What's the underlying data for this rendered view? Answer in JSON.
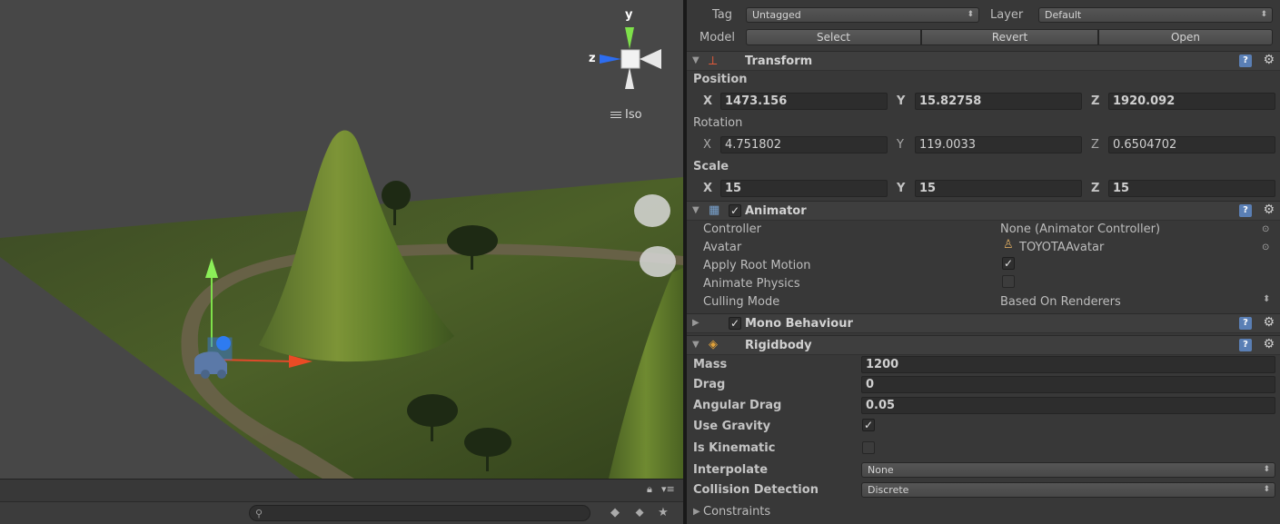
{
  "scene": {
    "gizmo": {
      "y_label": "y",
      "z_label": "z"
    },
    "projection_label": "Iso",
    "footer_icons": [
      "lock-icon",
      "menu-icon",
      "search-icon",
      "shapes-icon",
      "tag-icon",
      "star-icon"
    ]
  },
  "inspector": {
    "tag_label": "Tag",
    "tag_value": "Untagged",
    "layer_label": "Layer",
    "layer_value": "Default",
    "model_label": "Model",
    "model_buttons": {
      "select": "Select",
      "revert": "Revert",
      "open": "Open"
    },
    "transform": {
      "title": "Transform",
      "position_label": "Position",
      "position": {
        "x": "1473.156",
        "y": "15.82758",
        "z": "1920.092"
      },
      "rotation_label": "Rotation",
      "rotation": {
        "x": "4.751802",
        "y": "119.0033",
        "z": "0.6504702"
      },
      "scale_label": "Scale",
      "scale": {
        "x": "15",
        "y": "15",
        "z": "15"
      },
      "axis": {
        "x": "X",
        "y": "Y",
        "z": "Z"
      }
    },
    "animator": {
      "title": "Animator",
      "enabled": true,
      "controller_label": "Controller",
      "controller_value": "None (Animator Controller)",
      "avatar_label": "Avatar",
      "avatar_value": "TOYOTAAvatar",
      "apply_root_motion_label": "Apply Root Motion",
      "apply_root_motion": true,
      "animate_physics_label": "Animate Physics",
      "animate_physics": false,
      "culling_mode_label": "Culling Mode",
      "culling_mode_value": "Based On Renderers"
    },
    "mono_behaviour": {
      "title": "Mono Behaviour",
      "enabled": true
    },
    "rigidbody": {
      "title": "Rigidbody",
      "mass_label": "Mass",
      "mass": "1200",
      "drag_label": "Drag",
      "drag": "0",
      "angular_drag_label": "Angular Drag",
      "angular_drag": "0.05",
      "use_gravity_label": "Use Gravity",
      "use_gravity": true,
      "is_kinematic_label": "Is Kinematic",
      "is_kinematic": false,
      "interpolate_label": "Interpolate",
      "interpolate_value": "None",
      "collision_detection_label": "Collision Detection",
      "collision_detection_value": "Discrete",
      "constraints_label": "Constraints"
    },
    "colors": {
      "help_icon": "#5a7fb5",
      "panel_bg": "#383838",
      "field_bg": "#2d2d2d"
    }
  }
}
